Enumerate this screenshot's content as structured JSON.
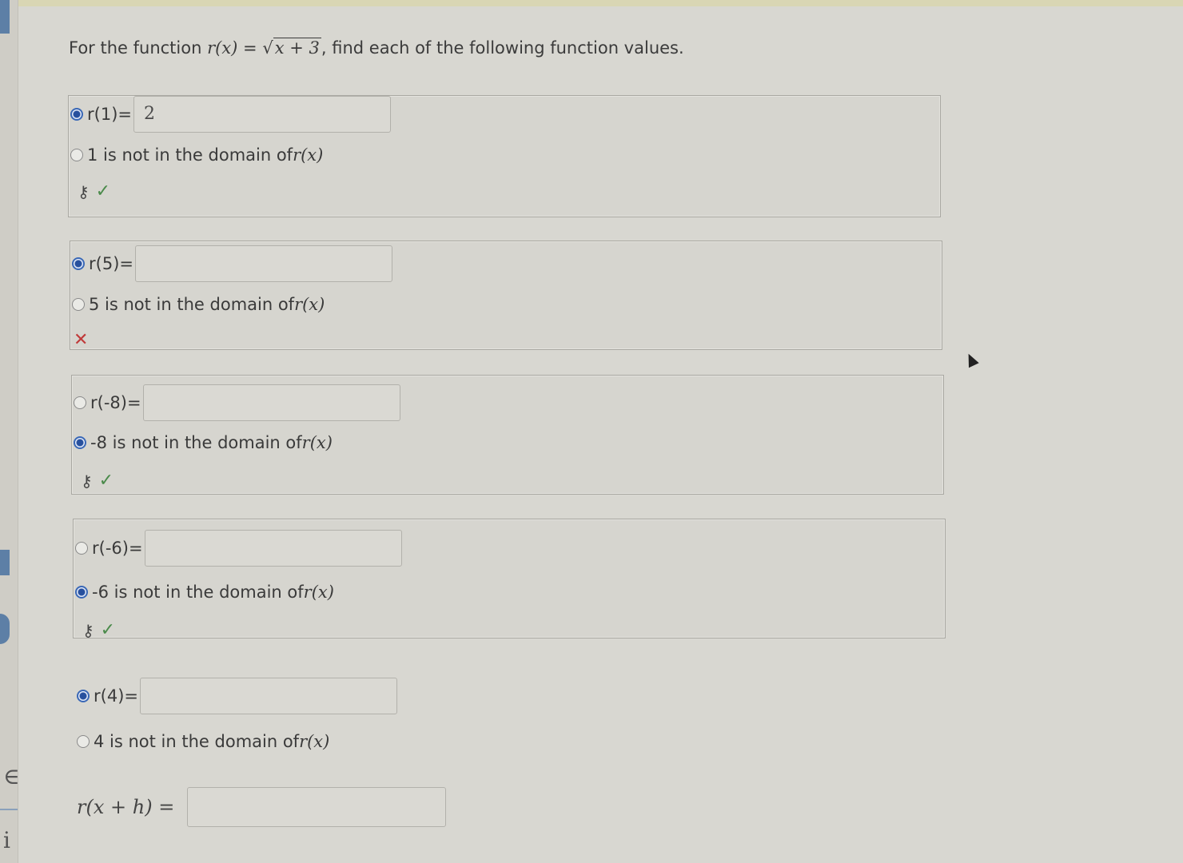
{
  "prompt": {
    "prefix": "For the function ",
    "func_lhs": "r(x)",
    "equals": " = ",
    "sqrt": "√",
    "radicand": "x + 3",
    "suffix": ", find each of the following function values."
  },
  "questions": [
    {
      "value_label": "r(1)=",
      "value": "2",
      "domain_label": "1 is not in the domain of ",
      "domain_func": "r(x)",
      "selected": "value",
      "status": "correct"
    },
    {
      "value_label": "r(5)=",
      "value": "",
      "domain_label": "5 is not in the domain of ",
      "domain_func": "r(x)",
      "selected": "value",
      "status": "incorrect"
    },
    {
      "value_label": "r(-8)=",
      "value": "",
      "domain_label": "-8 is not in the domain of ",
      "domain_func": "r(x)",
      "selected": "domain",
      "status": "correct"
    },
    {
      "value_label": "r(-6)=",
      "value": "",
      "domain_label": "-6 is not in the domain of ",
      "domain_func": "r(x)",
      "selected": "domain",
      "status": "correct"
    },
    {
      "value_label": "r(4)=",
      "value": "",
      "domain_label": "4 is not in the domain of ",
      "domain_func": "r(x)",
      "selected": "value",
      "status": "none"
    }
  ],
  "final": {
    "label": "r(x + h) =",
    "value": ""
  },
  "icons": {
    "key": "⚷",
    "check": "✓",
    "cross": "✕",
    "cursor": "mouse-pointer-icon"
  },
  "edge_glyphs": [
    "∈",
    "i"
  ],
  "colors": {
    "radio_selected": "#27509e",
    "check": "#4a8a4a",
    "cross": "#c03a3a",
    "edge_tab": "#5d7fa6"
  }
}
